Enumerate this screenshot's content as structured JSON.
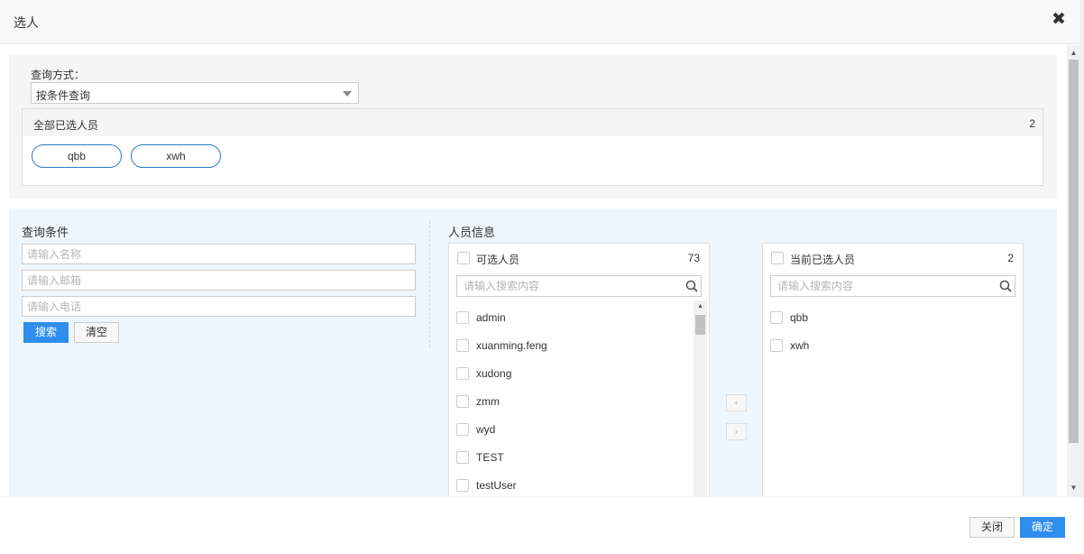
{
  "dialog": {
    "title": "选人",
    "close_icon": "close-icon"
  },
  "query_mode": {
    "label": "查询方式：",
    "selected": "按条件查询"
  },
  "all_selected": {
    "title": "全部已选人员",
    "count": "2",
    "items": [
      "qbb",
      "xwh"
    ]
  },
  "conditions": {
    "title": "查询条件",
    "name_placeholder": "请输入名称",
    "email_placeholder": "请输入邮箱",
    "phone_placeholder": "请输入电话",
    "search_label": "搜索",
    "clear_label": "清空"
  },
  "people_info": {
    "title": "人员信息",
    "available": {
      "title": "可选人员",
      "count": "73",
      "search_placeholder": "请输入搜索内容",
      "items": [
        "admin",
        "xuanming.feng",
        "xudong",
        "zmm",
        "wyd",
        "TEST",
        "testUser"
      ]
    },
    "move_left_label": "‹",
    "move_right_label": "›",
    "current": {
      "title": "当前已选人员",
      "count": "2",
      "search_placeholder": "请输入搜索内容",
      "items": [
        "qbb",
        "xwh"
      ]
    }
  },
  "footer": {
    "close_label": "关闭",
    "ok_label": "确定"
  },
  "colors": {
    "primary": "#2e8ded",
    "pill_border": "#2b7ac4",
    "lower_section_bg": "#eef6fd"
  }
}
